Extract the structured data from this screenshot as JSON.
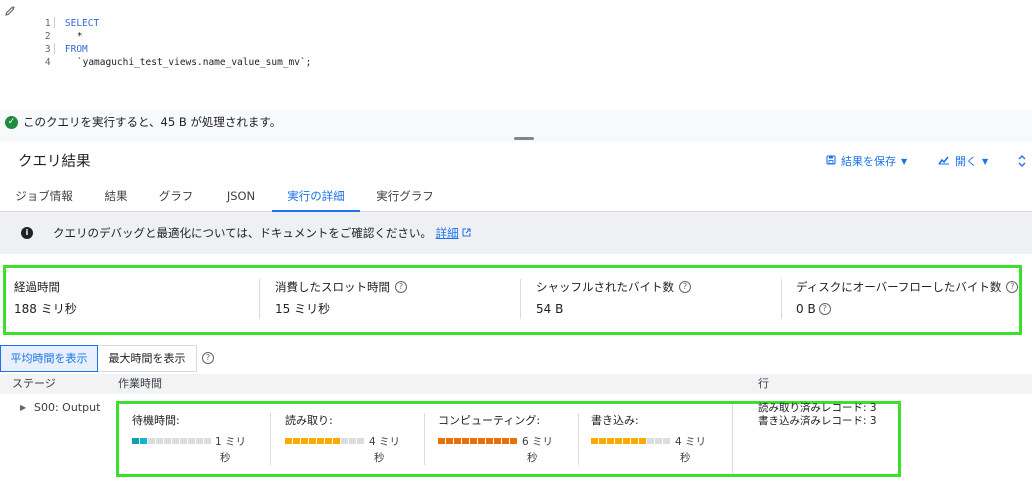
{
  "editor": {
    "lines": [
      {
        "num": "1",
        "text": "SELECT"
      },
      {
        "num": "2",
        "text": "*"
      },
      {
        "num": "3",
        "text": "FROM"
      },
      {
        "num": "4",
        "text": "`yamaguchi_test_views.name_value_sum_mv`",
        "suffix": ";"
      }
    ]
  },
  "status": {
    "message": "このクエリを実行すると、45 B が処理されます。"
  },
  "results": {
    "title": "クエリ結果",
    "save_label": "結果を保存",
    "open_label": "開く"
  },
  "tabs": [
    {
      "label": "ジョブ情報"
    },
    {
      "label": "結果"
    },
    {
      "label": "グラフ"
    },
    {
      "label": "JSON"
    },
    {
      "label": "実行の詳細",
      "active": true
    },
    {
      "label": "実行グラフ"
    }
  ],
  "info": {
    "text": "クエリのデバッグと最適化については、ドキュメントをご確認ください。",
    "link": "詳細"
  },
  "stats": [
    {
      "label": "経過時間",
      "value": "188 ミリ秒",
      "help": false
    },
    {
      "label": "消費したスロット時間",
      "value": "15 ミリ秒",
      "help": true
    },
    {
      "label": "シャッフルされたバイト数",
      "value": "54 B",
      "help": true
    },
    {
      "label": "ディスクにオーバーフローしたバイト数",
      "value": "0 B",
      "help": true
    }
  ],
  "toggle": {
    "avg_label": "平均時間を表示",
    "max_label": "最大時間を表示"
  },
  "table": {
    "headers": {
      "stage": "ステージ",
      "work_time": "作業時間",
      "rows": "行"
    },
    "stage_name": "S00: Output",
    "timings": [
      {
        "label": "待機時間:",
        "value_line1": "1 ミリ",
        "value_line2": "秒",
        "fraction": 0.2,
        "color": "#12b5cb",
        "accent": "#129eaf"
      },
      {
        "label": "読み取り:",
        "value_line1": "4 ミリ",
        "value_line2": "秒",
        "fraction": 0.67,
        "color": "#f9ab00",
        "accent": "#f9ab00"
      },
      {
        "label": "コンピューティング:",
        "value_line1": "6 ミリ",
        "value_line2": "秒",
        "fraction": 1.0,
        "color": "#e8710a",
        "accent": "#e8710a"
      },
      {
        "label": "書き込み:",
        "value_line1": "4 ミリ",
        "value_line2": "秒",
        "fraction": 0.67,
        "color": "#f9ab00",
        "accent": "#f9ab00"
      }
    ],
    "rows_read": "読み取り済みレコード: 3",
    "rows_written": "書き込み済みレコード: 3"
  },
  "icons": {
    "status": "check-circle-icon",
    "save": "save-icon",
    "open": "chart-icon",
    "expand": "unfold-icon",
    "info": "info-icon",
    "help": "help-icon",
    "external": "open-in-new-icon",
    "chevron": "chevron-right-icon",
    "edit": "edit-icon"
  }
}
